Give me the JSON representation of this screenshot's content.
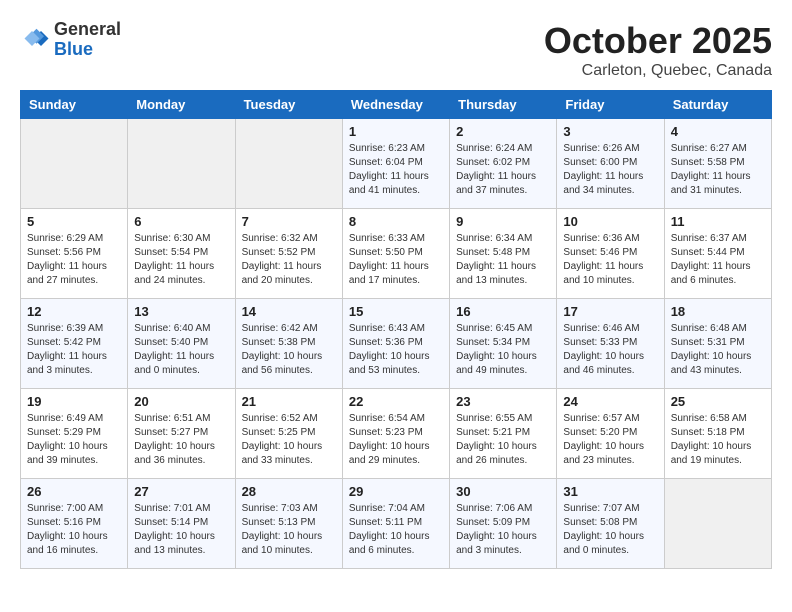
{
  "header": {
    "logo_general": "General",
    "logo_blue": "Blue",
    "month_title": "October 2025",
    "location": "Carleton, Quebec, Canada"
  },
  "weekdays": [
    "Sunday",
    "Monday",
    "Tuesday",
    "Wednesday",
    "Thursday",
    "Friday",
    "Saturday"
  ],
  "weeks": [
    [
      {
        "day": "",
        "info": ""
      },
      {
        "day": "",
        "info": ""
      },
      {
        "day": "",
        "info": ""
      },
      {
        "day": "1",
        "info": "Sunrise: 6:23 AM\nSunset: 6:04 PM\nDaylight: 11 hours\nand 41 minutes."
      },
      {
        "day": "2",
        "info": "Sunrise: 6:24 AM\nSunset: 6:02 PM\nDaylight: 11 hours\nand 37 minutes."
      },
      {
        "day": "3",
        "info": "Sunrise: 6:26 AM\nSunset: 6:00 PM\nDaylight: 11 hours\nand 34 minutes."
      },
      {
        "day": "4",
        "info": "Sunrise: 6:27 AM\nSunset: 5:58 PM\nDaylight: 11 hours\nand 31 minutes."
      }
    ],
    [
      {
        "day": "5",
        "info": "Sunrise: 6:29 AM\nSunset: 5:56 PM\nDaylight: 11 hours\nand 27 minutes."
      },
      {
        "day": "6",
        "info": "Sunrise: 6:30 AM\nSunset: 5:54 PM\nDaylight: 11 hours\nand 24 minutes."
      },
      {
        "day": "7",
        "info": "Sunrise: 6:32 AM\nSunset: 5:52 PM\nDaylight: 11 hours\nand 20 minutes."
      },
      {
        "day": "8",
        "info": "Sunrise: 6:33 AM\nSunset: 5:50 PM\nDaylight: 11 hours\nand 17 minutes."
      },
      {
        "day": "9",
        "info": "Sunrise: 6:34 AM\nSunset: 5:48 PM\nDaylight: 11 hours\nand 13 minutes."
      },
      {
        "day": "10",
        "info": "Sunrise: 6:36 AM\nSunset: 5:46 PM\nDaylight: 11 hours\nand 10 minutes."
      },
      {
        "day": "11",
        "info": "Sunrise: 6:37 AM\nSunset: 5:44 PM\nDaylight: 11 hours\nand 6 minutes."
      }
    ],
    [
      {
        "day": "12",
        "info": "Sunrise: 6:39 AM\nSunset: 5:42 PM\nDaylight: 11 hours\nand 3 minutes."
      },
      {
        "day": "13",
        "info": "Sunrise: 6:40 AM\nSunset: 5:40 PM\nDaylight: 11 hours\nand 0 minutes."
      },
      {
        "day": "14",
        "info": "Sunrise: 6:42 AM\nSunset: 5:38 PM\nDaylight: 10 hours\nand 56 minutes."
      },
      {
        "day": "15",
        "info": "Sunrise: 6:43 AM\nSunset: 5:36 PM\nDaylight: 10 hours\nand 53 minutes."
      },
      {
        "day": "16",
        "info": "Sunrise: 6:45 AM\nSunset: 5:34 PM\nDaylight: 10 hours\nand 49 minutes."
      },
      {
        "day": "17",
        "info": "Sunrise: 6:46 AM\nSunset: 5:33 PM\nDaylight: 10 hours\nand 46 minutes."
      },
      {
        "day": "18",
        "info": "Sunrise: 6:48 AM\nSunset: 5:31 PM\nDaylight: 10 hours\nand 43 minutes."
      }
    ],
    [
      {
        "day": "19",
        "info": "Sunrise: 6:49 AM\nSunset: 5:29 PM\nDaylight: 10 hours\nand 39 minutes."
      },
      {
        "day": "20",
        "info": "Sunrise: 6:51 AM\nSunset: 5:27 PM\nDaylight: 10 hours\nand 36 minutes."
      },
      {
        "day": "21",
        "info": "Sunrise: 6:52 AM\nSunset: 5:25 PM\nDaylight: 10 hours\nand 33 minutes."
      },
      {
        "day": "22",
        "info": "Sunrise: 6:54 AM\nSunset: 5:23 PM\nDaylight: 10 hours\nand 29 minutes."
      },
      {
        "day": "23",
        "info": "Sunrise: 6:55 AM\nSunset: 5:21 PM\nDaylight: 10 hours\nand 26 minutes."
      },
      {
        "day": "24",
        "info": "Sunrise: 6:57 AM\nSunset: 5:20 PM\nDaylight: 10 hours\nand 23 minutes."
      },
      {
        "day": "25",
        "info": "Sunrise: 6:58 AM\nSunset: 5:18 PM\nDaylight: 10 hours\nand 19 minutes."
      }
    ],
    [
      {
        "day": "26",
        "info": "Sunrise: 7:00 AM\nSunset: 5:16 PM\nDaylight: 10 hours\nand 16 minutes."
      },
      {
        "day": "27",
        "info": "Sunrise: 7:01 AM\nSunset: 5:14 PM\nDaylight: 10 hours\nand 13 minutes."
      },
      {
        "day": "28",
        "info": "Sunrise: 7:03 AM\nSunset: 5:13 PM\nDaylight: 10 hours\nand 10 minutes."
      },
      {
        "day": "29",
        "info": "Sunrise: 7:04 AM\nSunset: 5:11 PM\nDaylight: 10 hours\nand 6 minutes."
      },
      {
        "day": "30",
        "info": "Sunrise: 7:06 AM\nSunset: 5:09 PM\nDaylight: 10 hours\nand 3 minutes."
      },
      {
        "day": "31",
        "info": "Sunrise: 7:07 AM\nSunset: 5:08 PM\nDaylight: 10 hours\nand 0 minutes."
      },
      {
        "day": "",
        "info": ""
      }
    ]
  ]
}
